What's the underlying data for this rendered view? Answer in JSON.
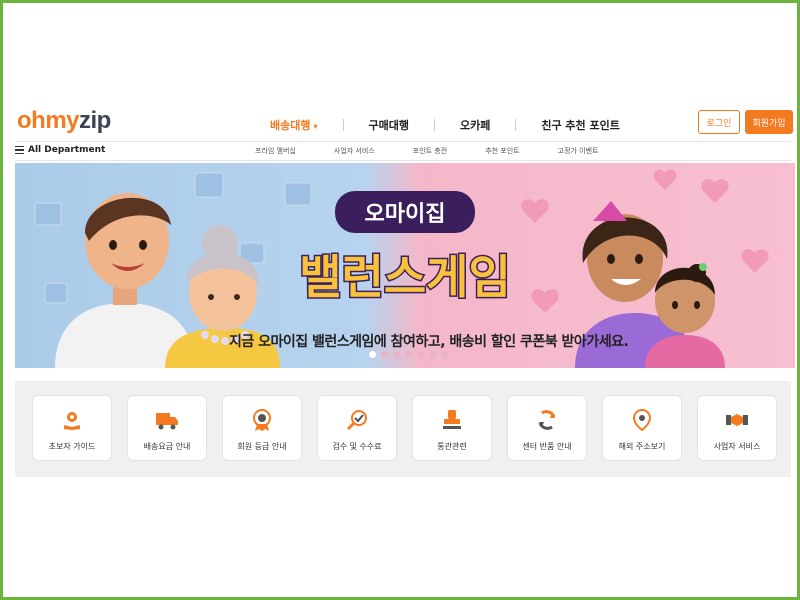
{
  "brand": {
    "logo_oh": "oh",
    "logo_my": "my",
    "logo_zip": "zip",
    "accent": "#f47a20"
  },
  "nav": {
    "items": [
      {
        "label": "배송대행",
        "caret": "▾",
        "active": true
      },
      {
        "label": "구매대행"
      },
      {
        "label": "오카페"
      },
      {
        "label": "친구 추천 포인트"
      }
    ],
    "login": "로그인",
    "join": "회원가입"
  },
  "subnav": {
    "all_department": "All Department",
    "links": [
      "프라임 멤버십",
      "사업자 서비스",
      "포인트 충전",
      "추천 포인트",
      "고정가 이벤트"
    ]
  },
  "banner": {
    "title_top": "오마이집",
    "title_main": "밸런스게임",
    "caption": "지금 오마이집 밸런스게임에 참여하고, 배송비 할인 쿠폰북 받아가세요.",
    "slide_count": 7,
    "active_slide": 1
  },
  "services": [
    {
      "label": "초보자 가이드",
      "icon": "gear-book-icon"
    },
    {
      "label": "배송요금 안내",
      "icon": "truck-icon"
    },
    {
      "label": "회원 등급 안내",
      "icon": "medal-icon"
    },
    {
      "label": "검수 및 수수료",
      "icon": "magnifier-check-icon"
    },
    {
      "label": "통관관련",
      "icon": "stamp-icon"
    },
    {
      "label": "센터 반품 안내",
      "icon": "return-arrows-icon"
    },
    {
      "label": "해외 주소보기",
      "icon": "map-pin-icon"
    },
    {
      "label": "사업자 서비스",
      "icon": "handshake-icon"
    }
  ]
}
